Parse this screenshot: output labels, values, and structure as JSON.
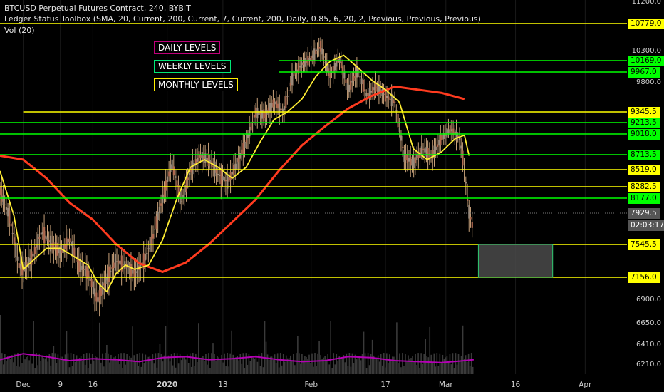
{
  "header": {
    "line1": "BTCUSD Perpetual Futures Contract, 240, BYBIT",
    "line2": "Ledger Status Toolbox (SMA, 20, Current, 200, Current, 7, Current, 200, Daily, 0.85, 6, 20, 2, Previous, Previous, Previous)",
    "line3": "Vol (20)"
  },
  "legend": {
    "daily": "DAILY LEVELS",
    "weekly": "WEEKLY LEVELS",
    "monthly": "MONTHLY LEVELS",
    "daily_color": "#c0007a",
    "weekly_color": "#00e676",
    "monthly_color": "#ffee00"
  },
  "colors": {
    "background": "#000000",
    "monthly_line": "#ffff00",
    "weekly_line": "#00ff00",
    "sma_fast": "#ffee33",
    "sma_slow": "#ff3b1f",
    "volume_ma": "#b400b4",
    "candles": "#c9a27a",
    "rect": "#4a4a4a"
  },
  "chart_data": {
    "type": "line",
    "price_axis_ticks": [
      "11200.0",
      "10300.0",
      "9800.0",
      "9345.5",
      "9213.5",
      "9018.0",
      "8713.5",
      "8519.0",
      "8282.5",
      "8177.0",
      "7929.5",
      "7545.5",
      "7156.0",
      "6900.0",
      "6650.0",
      "6410.0",
      "6210.0"
    ],
    "plain_ticks": [
      {
        "label": "11200.0",
        "value": 11200
      },
      {
        "label": "10300.0",
        "value": 10300
      },
      {
        "label": "9800.0",
        "value": 9800
      },
      {
        "label": "6900.0",
        "value": 6900
      },
      {
        "label": "6650.0",
        "value": 6650
      },
      {
        "label": "6410.0",
        "value": 6410
      },
      {
        "label": "6210.0",
        "value": 6210
      }
    ],
    "levels": [
      {
        "label": "10779.0",
        "value": 10779.0,
        "type": "monthly",
        "start": "Nov 26"
      },
      {
        "label": "10169.0",
        "value": 10169.0,
        "type": "weekly",
        "start": "Jan 25"
      },
      {
        "label": "9967.0",
        "value": 9967.0,
        "type": "weekly",
        "start": "Jan 25"
      },
      {
        "label": "9345.5",
        "value": 9345.5,
        "type": "monthly",
        "start": "Dec 1"
      },
      {
        "label": "9213.5",
        "value": 9213.5,
        "type": "weekly",
        "start": "Nov 26"
      },
      {
        "label": "9018.0",
        "value": 9018.0,
        "type": "weekly",
        "start": "Nov 26"
      },
      {
        "label": "8713.5",
        "value": 8713.5,
        "type": "weekly",
        "start": "Nov 26"
      },
      {
        "label": "8519.0",
        "value": 8519.0,
        "type": "monthly",
        "start": "Dec 1"
      },
      {
        "label": "8282.5",
        "value": 8282.5,
        "type": "monthly",
        "start": "Nov 26"
      },
      {
        "label": "8177.0",
        "value": 8177.0,
        "type": "weekly",
        "start": "Nov 26"
      },
      {
        "label": "7545.5",
        "value": 7545.5,
        "type": "monthly",
        "start": "Nov 26"
      },
      {
        "label": "7156.0",
        "value": 7156.0,
        "type": "monthly",
        "start": "Nov 26"
      }
    ],
    "last_price": {
      "label": "7929.5",
      "value": 7929.5
    },
    "countdown": "02:03:17",
    "x_ticks": [
      "Dec",
      "9",
      "16",
      "2020",
      "13",
      "Feb",
      "17",
      "Mar",
      "16",
      "Apr"
    ],
    "x_tick_days": [
      0,
      8,
      15,
      31,
      43,
      62,
      78,
      91,
      106,
      121
    ],
    "x_range_days": [
      -5,
      130
    ],
    "x_origin": "Dec 1",
    "y_range": [
      6150,
      11300
    ],
    "projection_box": {
      "x_start_day": 98,
      "x_end_day": 114,
      "y_top": 7545.5,
      "y_bottom": 7156.0
    },
    "price_series": {
      "name": "BTCUSD",
      "x_day": [
        -5,
        -3,
        -1,
        0,
        2,
        4,
        6,
        8,
        10,
        12,
        14,
        16,
        18,
        20,
        22,
        24,
        26,
        28,
        30,
        32,
        34,
        36,
        38,
        40,
        42,
        44,
        46,
        48,
        50,
        52,
        54,
        56,
        58,
        60,
        62,
        64,
        66,
        68,
        70,
        72,
        74,
        76,
        78,
        80,
        82,
        84,
        86,
        88,
        90,
        92,
        94,
        95,
        96,
        97
      ],
      "y": [
        8250,
        7900,
        7300,
        7250,
        7400,
        7700,
        7550,
        7450,
        7600,
        7300,
        7200,
        6900,
        7150,
        7350,
        7300,
        7200,
        7350,
        7650,
        8150,
        8600,
        8100,
        8500,
        8700,
        8650,
        8450,
        8350,
        8600,
        8900,
        9350,
        9300,
        9500,
        9350,
        9900,
        10100,
        10200,
        10400,
        9900,
        10200,
        9700,
        10000,
        9600,
        9750,
        9600,
        9500,
        8700,
        8600,
        8800,
        8700,
        8950,
        9100,
        8950,
        8500,
        7950,
        7700
      ]
    },
    "sma_fast": {
      "x_day": [
        -5,
        -2,
        0,
        2,
        5,
        8,
        11,
        14,
        16,
        18,
        20,
        22,
        24,
        27,
        30,
        33,
        36,
        39,
        42,
        45,
        48,
        51,
        54,
        57,
        60,
        63,
        66,
        69,
        72,
        75,
        78,
        81,
        84,
        87,
        90,
        93,
        95,
        96
      ],
      "y": [
        8500,
        7900,
        7250,
        7350,
        7500,
        7500,
        7400,
        7300,
        7100,
        7000,
        7200,
        7300,
        7250,
        7300,
        7600,
        8150,
        8550,
        8650,
        8550,
        8400,
        8550,
        8900,
        9250,
        9350,
        9550,
        9900,
        10150,
        10250,
        10050,
        9850,
        9700,
        9500,
        8800,
        8650,
        8750,
        8950,
        9000,
        8700
      ]
    },
    "sma_slow": {
      "x_day": [
        -5,
        0,
        5,
        10,
        15,
        20,
        25,
        30,
        35,
        40,
        45,
        50,
        55,
        60,
        65,
        70,
        75,
        80,
        85,
        90,
        95
      ],
      "y": [
        8700,
        8650,
        8400,
        8100,
        7850,
        7550,
        7320,
        7220,
        7330,
        7550,
        7820,
        8150,
        8500,
        8850,
        9150,
        9400,
        9600,
        9750,
        9700,
        9650,
        9550
      ]
    },
    "volume_ma": {
      "x_day": [
        -5,
        0,
        5,
        10,
        15,
        20,
        25,
        30,
        35,
        40,
        45,
        50,
        55,
        60,
        65,
        70,
        75,
        80,
        85,
        90,
        95,
        97
      ],
      "y": [
        6270,
        6330,
        6300,
        6260,
        6280,
        6270,
        6250,
        6290,
        6300,
        6270,
        6280,
        6300,
        6270,
        6250,
        6260,
        6300,
        6290,
        6260,
        6250,
        6240,
        6260,
        6270
      ]
    }
  }
}
